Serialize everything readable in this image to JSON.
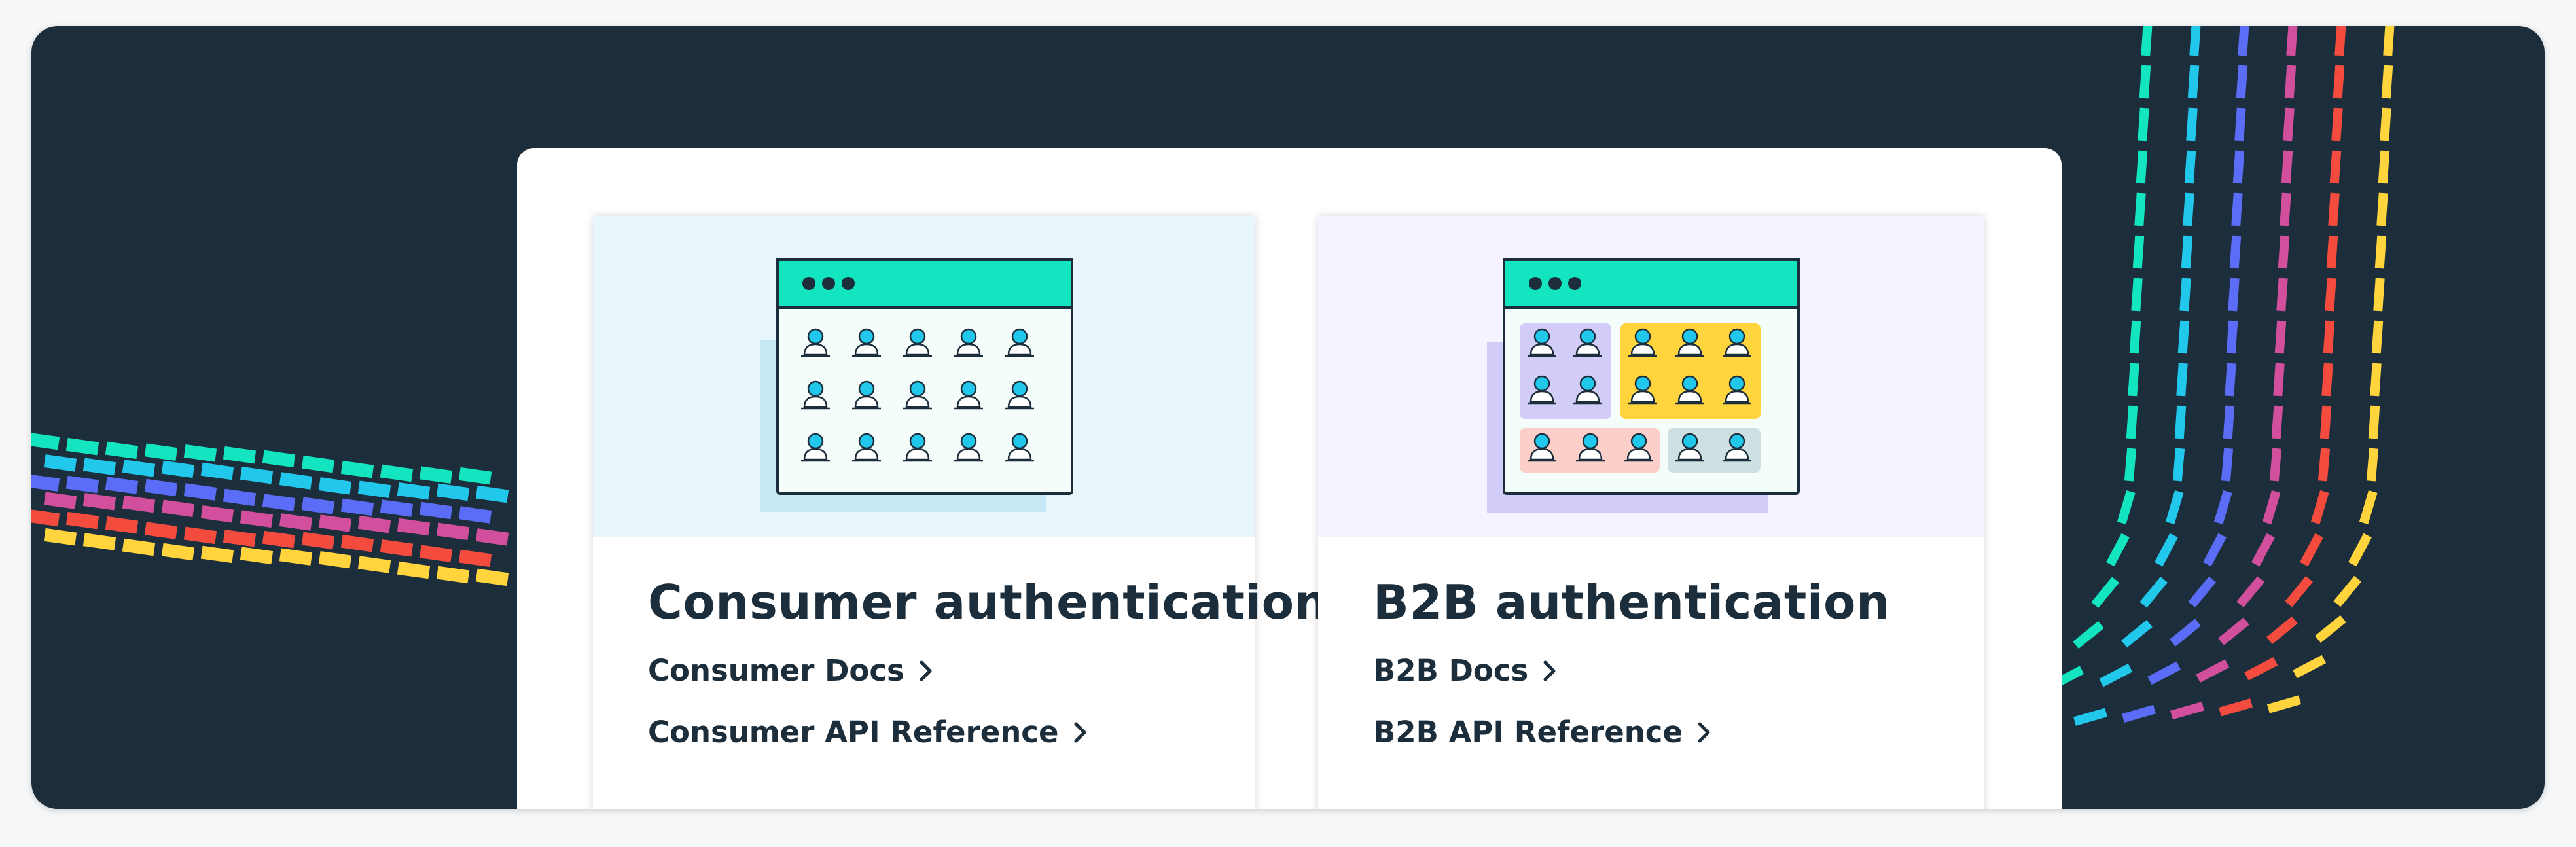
{
  "cards": [
    {
      "title": "Consumer authentication",
      "links": [
        {
          "label": "Consumer Docs"
        },
        {
          "label": "Consumer API Reference"
        }
      ]
    },
    {
      "title": "B2B authentication",
      "links": [
        {
          "label": "B2B Docs"
        },
        {
          "label": "B2B API Reference"
        }
      ]
    }
  ],
  "colors": {
    "background": "#1c2e3b",
    "text": "#1c2e3b",
    "teal": "#13e5c0",
    "cyan": "#21c8ec",
    "blue": "#5b6cf6",
    "pink": "#d14f9c",
    "red": "#f44b3f",
    "yellow": "#ffd43d",
    "consumer_tint": "#e8f6fc",
    "b2b_tint": "#f4f3ff"
  },
  "icons": [
    "browser-window-icon",
    "user-icon",
    "chevron-right-icon"
  ]
}
